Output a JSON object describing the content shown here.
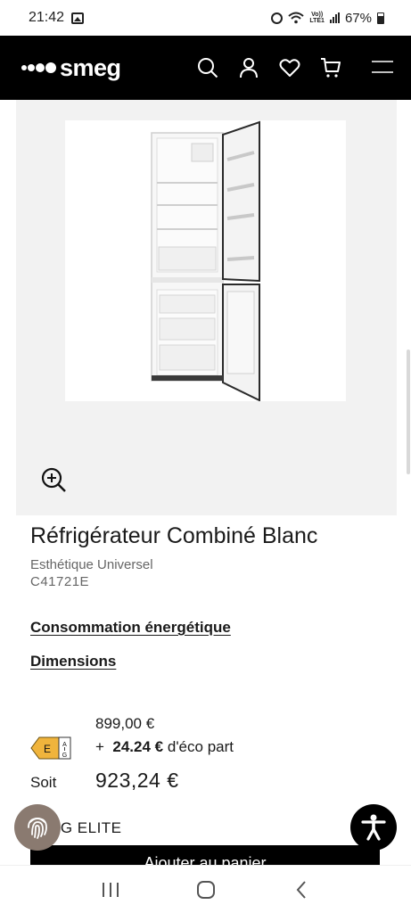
{
  "status_bar": {
    "time": "21:42",
    "volte": [
      "Vo))",
      "LTE1"
    ],
    "battery": "67%"
  },
  "header": {
    "logo": "smeg",
    "icons": [
      "search-icon",
      "user-icon",
      "heart-icon",
      "cart-icon",
      "menu-icon"
    ]
  },
  "product": {
    "title": "Réfrigérateur Combiné Blanc",
    "subtitle": "Esthétique Universel",
    "code": "C41721E",
    "links": {
      "energy": "Consommation énergétique",
      "dimensions": "Dimensions"
    }
  },
  "price": {
    "base": "899,00 €",
    "eco_prefix": "+",
    "eco_amount": "24.24 €",
    "eco_suffix": "d'éco part",
    "soit_label": "Soit",
    "total": "923,24 €",
    "energy_class": "E",
    "energy_scale_top": "A",
    "energy_scale_bottom": "G"
  },
  "bottom": {
    "elite_text": "EG ELITE",
    "cart_button": "Ajouter au panier"
  },
  "colors": {
    "header_bg": "#000000",
    "gallery_bg": "#f2f2f2",
    "energy_label": "#f0b43c",
    "fingerprint_bg": "#8a7a70"
  }
}
